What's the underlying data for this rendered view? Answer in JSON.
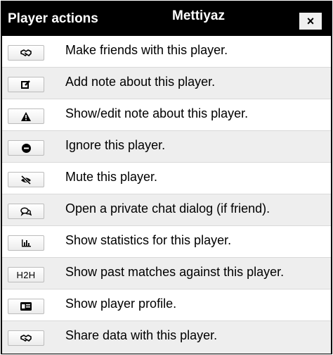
{
  "dialog": {
    "title": "Player actions",
    "player_name": "Mettiyaz",
    "close_label": "×"
  },
  "actions": [
    {
      "icon": "handshake-icon",
      "label": "Make friends with this player."
    },
    {
      "icon": "edit-note-icon",
      "label": "Add note about this player."
    },
    {
      "icon": "warning-icon",
      "label": "Show/edit note about this player."
    },
    {
      "icon": "minus-circle-icon",
      "label": "Ignore this player."
    },
    {
      "icon": "eye-slash-icon",
      "label": "Mute this player."
    },
    {
      "icon": "chat-bubbles-icon",
      "label": "Open a private chat dialog (if friend)."
    },
    {
      "icon": "bar-chart-icon",
      "label": "Show statistics for this player."
    },
    {
      "icon": "h2h-text",
      "button_text": "H2H",
      "label": "Show past matches against this player."
    },
    {
      "icon": "id-card-icon",
      "label": "Show player profile."
    },
    {
      "icon": "handshake-icon",
      "label": "Share data with this player."
    }
  ]
}
